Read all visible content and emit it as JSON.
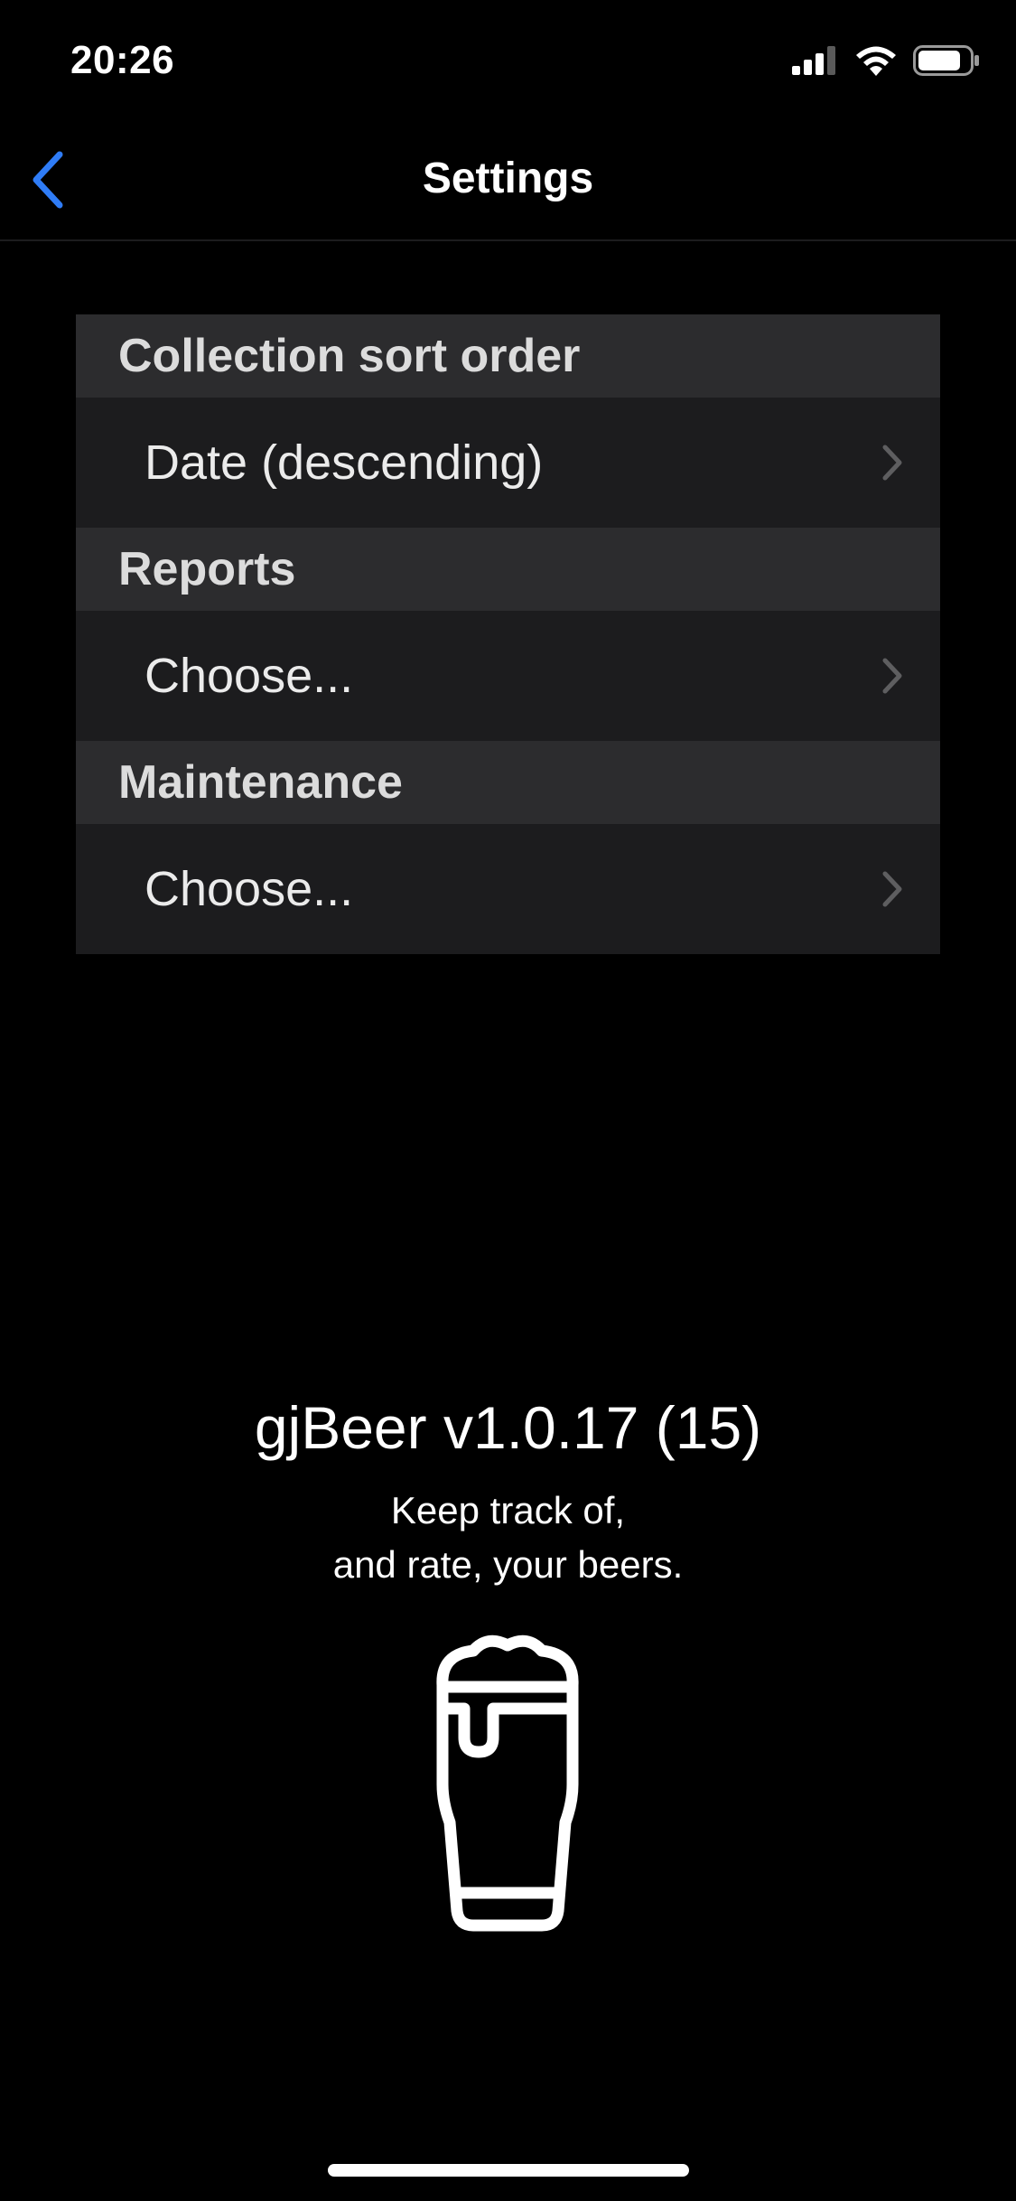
{
  "status_bar": {
    "time": "20:26",
    "icons": [
      "cellular-signal-icon",
      "wifi-icon",
      "battery-icon"
    ]
  },
  "nav": {
    "title": "Settings",
    "back_icon": "chevron-left-icon",
    "accent_color": "#2f7cf6"
  },
  "settings": {
    "sections": [
      {
        "header": "Collection sort order",
        "value": "Date (descending)"
      },
      {
        "header": "Reports",
        "value": "Choose..."
      },
      {
        "header": "Maintenance",
        "value": "Choose..."
      }
    ]
  },
  "about": {
    "version": "gjBeer v1.0.17 (15)",
    "tagline_line1": "Keep track of,",
    "tagline_line2": "and rate, your beers.",
    "logo_icon": "beer-glass-icon"
  }
}
